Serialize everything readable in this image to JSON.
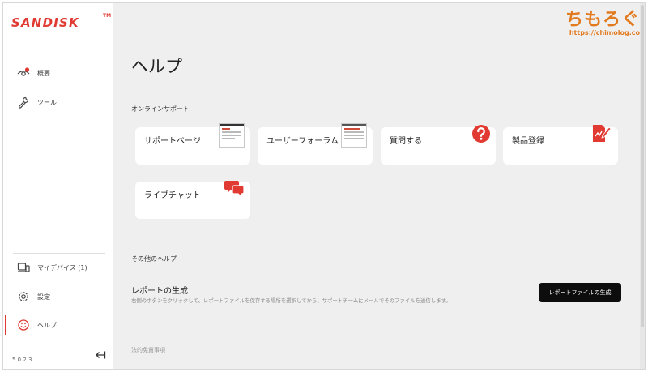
{
  "app": {
    "logo": "SANDISK",
    "logo_tm": "TM",
    "version": "5.0.2.3"
  },
  "sidebar": {
    "items": [
      {
        "label": "概要",
        "icon": "eye-icon",
        "badge": true
      },
      {
        "label": "ツール",
        "icon": "wrench-icon"
      },
      {
        "label": "マイデバイス (1)",
        "icon": "devices-icon"
      },
      {
        "label": "設定",
        "icon": "gear-icon"
      },
      {
        "label": "ヘルプ",
        "icon": "smile-icon",
        "active": true
      }
    ]
  },
  "main": {
    "title": "ヘルプ",
    "online_support": {
      "heading": "オンラインサポート",
      "cards": [
        {
          "label": "サポートページ",
          "icon": "support-page-thumbnail"
        },
        {
          "label": "ユーザーフォーラム",
          "icon": "forum-thumbnail"
        },
        {
          "label": "質問する",
          "icon": "question-icon"
        },
        {
          "label": "製品登録",
          "icon": "register-icon"
        },
        {
          "label": "ライブチャット",
          "icon": "chat-icon"
        }
      ]
    },
    "other_help": {
      "heading": "その他のヘルプ",
      "report_title": "レポートの生成",
      "report_desc": "右側のボタンをクリックして、レポートファイルを保存する場所を選択してから、サポートチームにメールでそのファイルを送信します。",
      "report_button": "レポートファイルの生成"
    },
    "legal": "法的免責事項"
  },
  "watermark": {
    "text": "ちもろぐ",
    "url": "https://chimolog.co"
  },
  "colors": {
    "brand": "#e03a32",
    "button_bg": "#0d0d0d",
    "content_bg": "#efefef",
    "watermark": "#e27a1f"
  }
}
